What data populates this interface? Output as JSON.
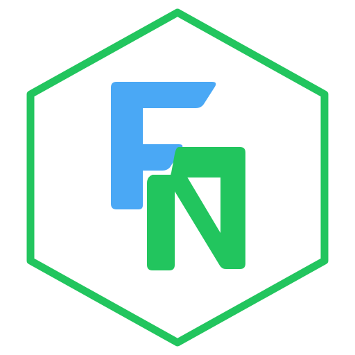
{
  "logo": {
    "monogram": "FN",
    "icon": "fn-monogram-hexagon-icon",
    "colors": {
      "hexagon_stroke": "#22c55e",
      "f_letter": "#4aa8f5",
      "n_letter": "#22c55e",
      "background": "#ffffff"
    }
  }
}
